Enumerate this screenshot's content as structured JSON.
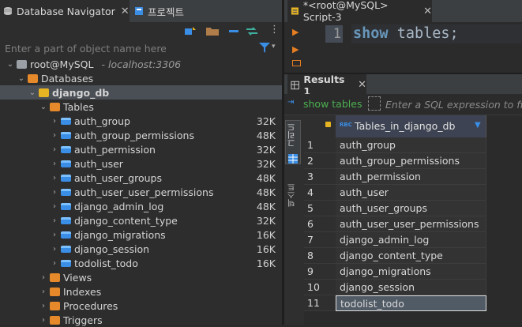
{
  "left_panel": {
    "tabs": [
      {
        "label": "Database Navigator",
        "icon": "database-navigator-icon"
      },
      {
        "label": "프로젝트",
        "icon": "project-icon"
      }
    ],
    "filter_placeholder": "Enter a part of object name here",
    "tree": [
      {
        "label": "root@MySQL",
        "hint": "- localhost:3306",
        "depth": 0,
        "chevron": "⌄",
        "icon": "connection-icon"
      },
      {
        "label": "Databases",
        "depth": 1,
        "chevron": "⌄",
        "icon": "folder-icon"
      },
      {
        "label": "django_db",
        "depth": 2,
        "chevron": "⌄",
        "icon": "database-icon",
        "selected": true
      },
      {
        "label": "Tables",
        "depth": 3,
        "chevron": "⌄",
        "icon": "tables-folder-icon"
      },
      {
        "label": "auth_group",
        "depth": 4,
        "chevron": "›",
        "icon": "table-icon",
        "size": "32K"
      },
      {
        "label": "auth_group_permissions",
        "depth": 4,
        "chevron": "›",
        "icon": "table-icon",
        "size": "48K"
      },
      {
        "label": "auth_permission",
        "depth": 4,
        "chevron": "›",
        "icon": "table-icon",
        "size": "32K"
      },
      {
        "label": "auth_user",
        "depth": 4,
        "chevron": "›",
        "icon": "table-icon",
        "size": "32K"
      },
      {
        "label": "auth_user_groups",
        "depth": 4,
        "chevron": "›",
        "icon": "table-icon",
        "size": "48K"
      },
      {
        "label": "auth_user_user_permissions",
        "depth": 4,
        "chevron": "›",
        "icon": "table-icon",
        "size": "48K"
      },
      {
        "label": "django_admin_log",
        "depth": 4,
        "chevron": "›",
        "icon": "table-icon",
        "size": "48K"
      },
      {
        "label": "django_content_type",
        "depth": 4,
        "chevron": "›",
        "icon": "table-icon",
        "size": "32K"
      },
      {
        "label": "django_migrations",
        "depth": 4,
        "chevron": "›",
        "icon": "table-icon",
        "size": "16K"
      },
      {
        "label": "django_session",
        "depth": 4,
        "chevron": "›",
        "icon": "table-icon",
        "size": "16K"
      },
      {
        "label": "todolist_todo",
        "depth": 4,
        "chevron": "›",
        "icon": "table-icon",
        "size": "16K"
      },
      {
        "label": "Views",
        "depth": 3,
        "chevron": "›",
        "icon": "views-folder-icon"
      },
      {
        "label": "Indexes",
        "depth": 3,
        "chevron": "›",
        "icon": "indexes-folder-icon"
      },
      {
        "label": "Procedures",
        "depth": 3,
        "chevron": "›",
        "icon": "procedures-folder-icon"
      },
      {
        "label": "Triggers",
        "depth": 3,
        "chevron": "›",
        "icon": "triggers-folder-icon"
      }
    ]
  },
  "editor": {
    "tab_label": "*<root@MySQL> Script-3",
    "line_number": "1",
    "keyword": "show",
    "rest": " tables;"
  },
  "results": {
    "tab_label": "Results 1",
    "query_label": "show tables",
    "filter_placeholder": "Enter a SQL expression to filter results (use Ctrl+Space)",
    "side_tabs": {
      "grid": "그리드",
      "text": "텍스트"
    },
    "column_header": "Tables_in_django_db",
    "column_type_badge": "RBC",
    "rows": [
      {
        "n": "1",
        "v": "auth_group"
      },
      {
        "n": "2",
        "v": "auth_group_permissions"
      },
      {
        "n": "3",
        "v": "auth_permission"
      },
      {
        "n": "4",
        "v": "auth_user"
      },
      {
        "n": "5",
        "v": "auth_user_groups"
      },
      {
        "n": "6",
        "v": "auth_user_user_permissions"
      },
      {
        "n": "7",
        "v": "django_admin_log"
      },
      {
        "n": "8",
        "v": "django_content_type"
      },
      {
        "n": "9",
        "v": "django_migrations"
      },
      {
        "n": "10",
        "v": "django_session"
      },
      {
        "n": "11",
        "v": "todolist_todo",
        "selected": true
      }
    ]
  },
  "colors": {
    "accent": "#3a8ee6",
    "keyword": "#6897bb",
    "orange": "#e67e22",
    "selection": "#4a4f55"
  }
}
